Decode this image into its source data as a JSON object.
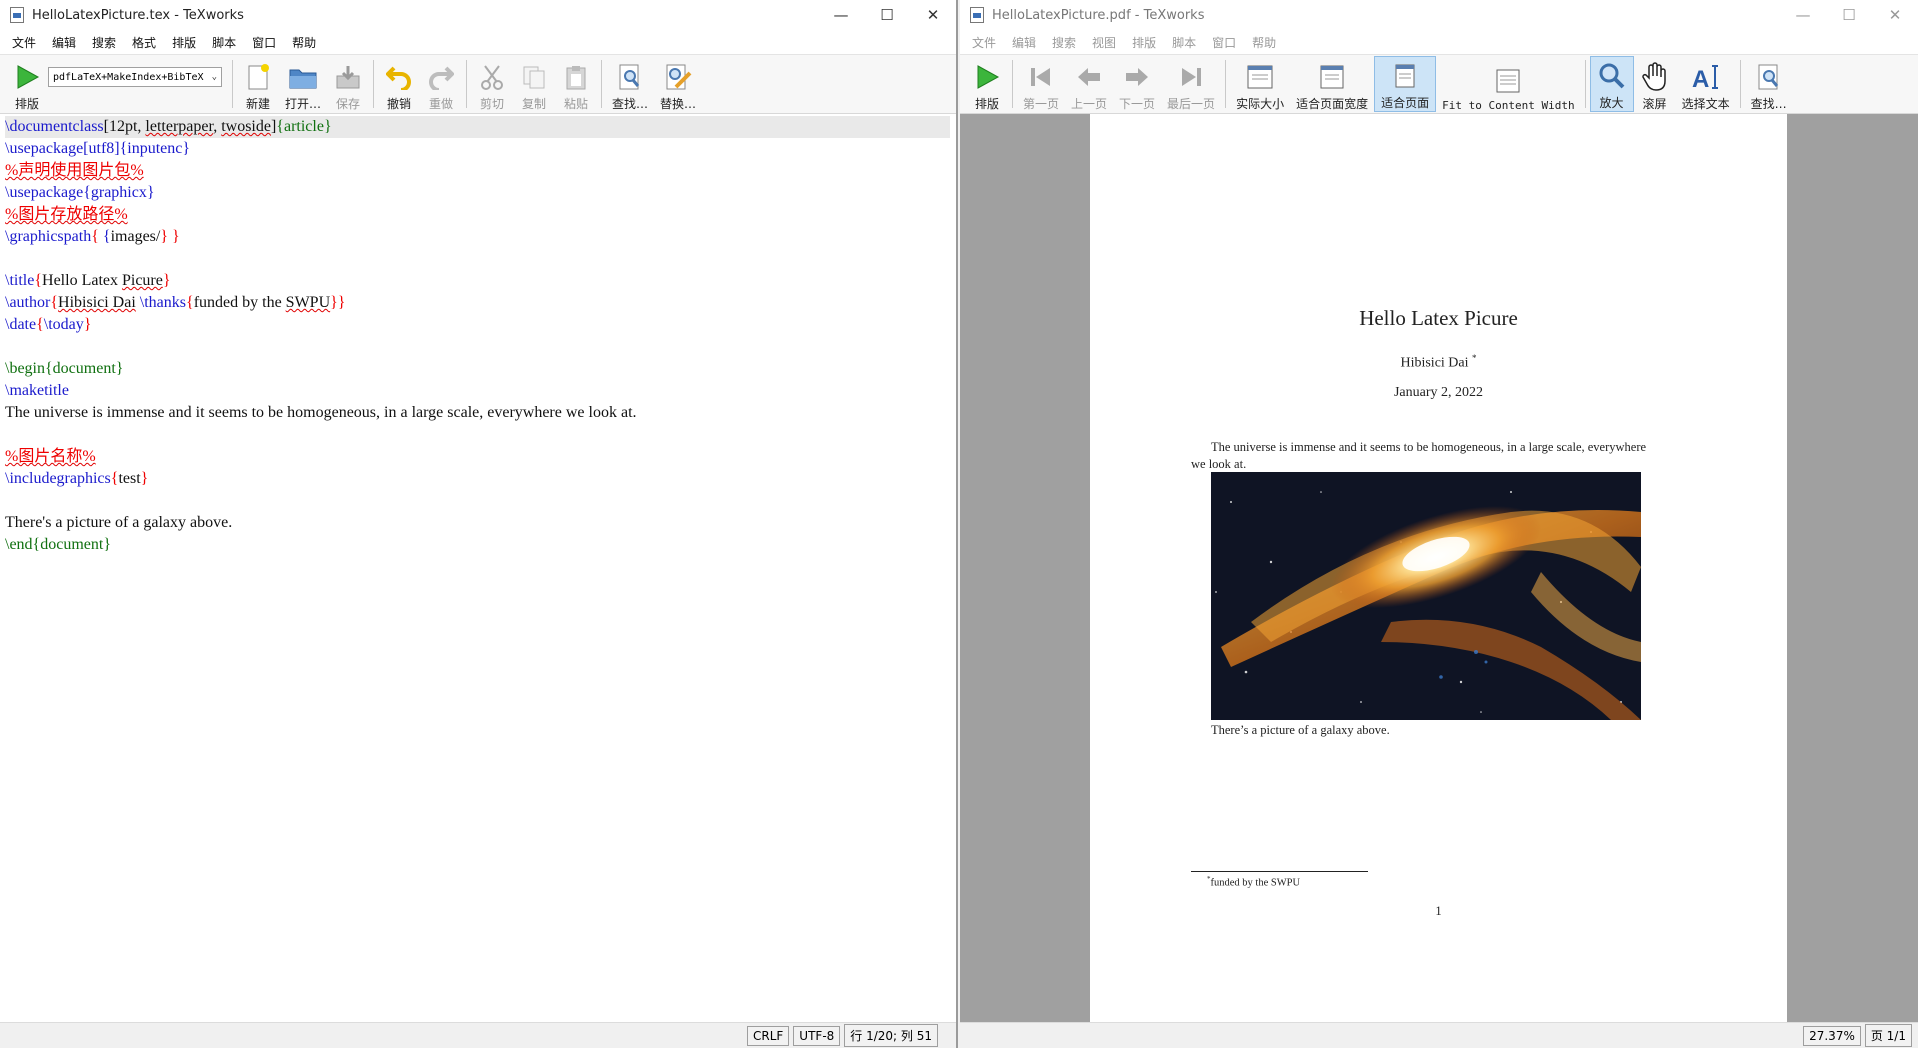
{
  "editor": {
    "title": "HelloLatexPicture.tex - TeXworks",
    "menu": [
      "文件",
      "编辑",
      "搜索",
      "格式",
      "排版",
      "脚本",
      "窗口",
      "帮助"
    ],
    "toolbar": {
      "typeset": "排版",
      "engine": "pdfLaTeX+MakeIndex+BibTeX",
      "new": "新建",
      "open": "打开…",
      "save": "保存",
      "undo": "撤销",
      "redo": "重做",
      "cut": "剪切",
      "copy": "复制",
      "paste": "粘贴",
      "find": "查找…",
      "replace": "替换…"
    },
    "code": {
      "l1": {
        "cmd": "\\documentclass",
        "opts": "[12pt, ",
        "opt2": "letterpaper",
        "c1": ", ",
        "opt3": "twoside",
        "c2": "]",
        "arg": "{article}"
      },
      "l2": {
        "cmd": "\\usepackage[utf8]",
        "arg": "{inputenc}"
      },
      "l3": {
        "text": "%声明使用图片包%"
      },
      "l4": {
        "cmd": "\\usepackage",
        "arg": "{graphicx}"
      },
      "l5": {
        "text": "%图片存放路径%"
      },
      "l6": {
        "cmd": "\\graphicspath",
        "b1": "{ ",
        "b2": "{",
        "inner": "images/",
        "b3": "} }"
      },
      "l7": {
        "cmd": "\\title",
        "b1": "{",
        "t1": "Hello Latex ",
        "t2": "Picure",
        "b2": "}"
      },
      "l8": {
        "cmd": "\\author",
        "b1": "{",
        "t1": "Hibisici Dai",
        "t1b": " ",
        "cmd2": "\\thanks",
        "b2": "{",
        "t2": "funded by the ",
        "t3": "SWPU",
        "b3": "}}"
      },
      "l9": {
        "cmd": "\\date",
        "b1": "{",
        "cmd2": "\\today",
        "b2": "}"
      },
      "l10": {
        "text": "\\begin{document}"
      },
      "l11": {
        "text": "\\maketitle"
      },
      "l12": {
        "text": "The universe is immense and it seems to be homogeneous, in a large scale, everywhere we look at."
      },
      "l13": {
        "text": "%图片名称%"
      },
      "l14": {
        "cmd": "\\includegraphics",
        "b1": "{",
        "t": "test",
        "b2": "}"
      },
      "l15": {
        "text": "There's a picture of a galaxy above."
      },
      "l16": {
        "text": "\\end{document}"
      }
    },
    "status": {
      "eol": "CRLF",
      "encoding": "UTF-8",
      "position": "行 1/20; 列 51"
    }
  },
  "viewer": {
    "title": "HelloLatexPicture.pdf - TeXworks",
    "menu": [
      "文件",
      "编辑",
      "搜索",
      "视图",
      "排版",
      "脚本",
      "窗口",
      "帮助"
    ],
    "toolbar": {
      "typeset": "排版",
      "first": "第一页",
      "prev": "上一页",
      "next": "下一页",
      "last": "最后一页",
      "actual": "实际大小",
      "fitwidth": "适合页面宽度",
      "fitpage": "适合页面",
      "fitcontent": "Fit to Content Width",
      "zoom": "放大",
      "scroll": "滚屏",
      "select": "选择文本",
      "find": "查找…"
    },
    "pdf": {
      "title": "Hello Latex Picure",
      "author": "Hibisici Dai",
      "author_mark": "*",
      "date": "January 2, 2022",
      "body": "The universe is immense and it seems to be homogeneous, in a large scale, everywhere we look at.",
      "caption": "There’s a picture of a galaxy above.",
      "footnote_mark": "*",
      "footnote": "funded by the SWPU",
      "page_number": "1"
    },
    "status": {
      "zoom": "27.37%",
      "page": "页 1/1"
    }
  }
}
